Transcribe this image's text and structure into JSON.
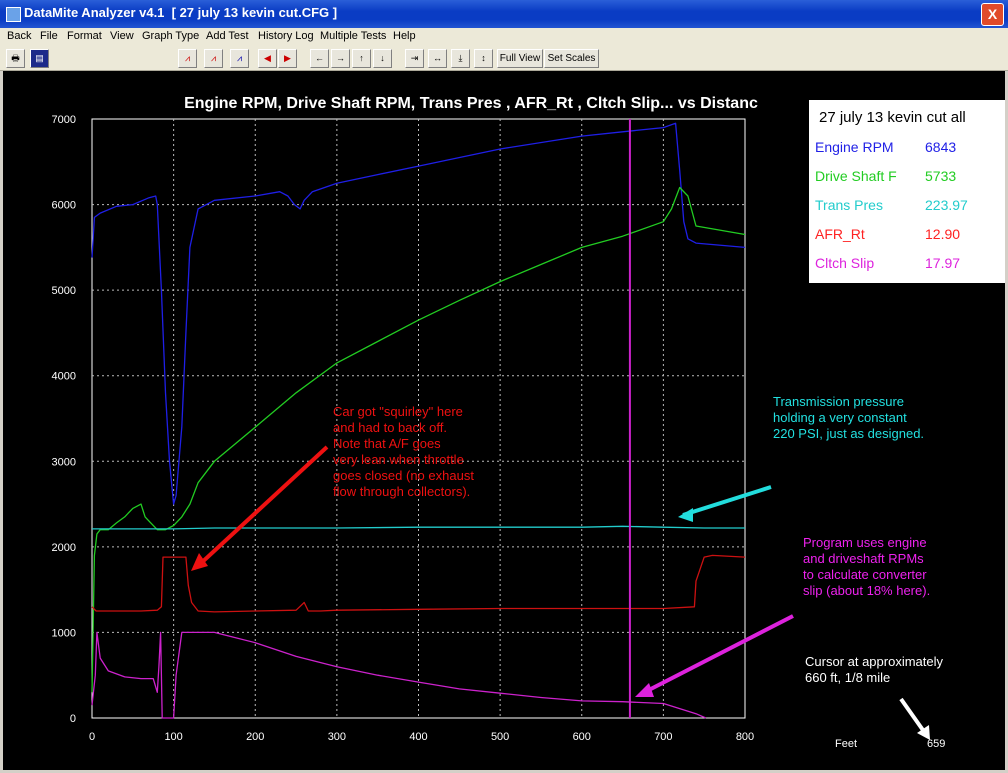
{
  "window": {
    "title": "DataMite Analyzer v4.1  [ 27 july 13 kevin cut.CFG ]",
    "close_glyph": "X"
  },
  "menu": [
    "Back",
    "File",
    "Format",
    "View",
    "Graph Type",
    "Add Test",
    "History Log",
    "Multiple Tests",
    "Help"
  ],
  "toolbar": {
    "icons": [
      "printer-icon",
      "save-icon",
      "graph-icon-1",
      "graph-icon-2",
      "graph-icon-3",
      "scroll-left-icon",
      "scroll-right-icon",
      "arrow-left-icon",
      "arrow-right-icon",
      "arrow-up-icon",
      "arrow-down-icon",
      "compress-horizontal-icon",
      "expand-horizontal-icon",
      "compress-vertical-icon",
      "expand-vertical-icon"
    ],
    "full_view": "Full View",
    "set_scales": "Set Scales"
  },
  "colors": {
    "engine_rpm": "#1f1fe6",
    "drive_shaft": "#22cc22",
    "trans_pres": "#22cccc",
    "afr": "#cc1111",
    "clutch_slip": "#cc22cc",
    "grid": "#bbbbbb",
    "cursor": "#cc22cc"
  },
  "legend": {
    "header": "27 july 13 kevin cut    all",
    "rows": [
      {
        "label": "Engine RPM",
        "value": "6843",
        "color": "#1f1fe6"
      },
      {
        "label": "Drive Shaft F",
        "value": "5733",
        "color": "#22cc22"
      },
      {
        "label": "Trans Pres",
        "value": "223.97",
        "color": "#22cccc"
      },
      {
        "label": "AFR_Rt",
        "value": "12.90",
        "color": "#ff2222"
      },
      {
        "label": "Cltch Slip",
        "value": "17.97",
        "color": "#dd22dd"
      }
    ]
  },
  "annotations": {
    "squirley": [
      "Car got \"squirley\" here",
      "and had to back off.",
      "Note that A/F goes",
      "very lean when throttle",
      "goes closed (no exhaust",
      "flow through collectors)."
    ],
    "transmission": [
      "Transmission pressure",
      "holding a very constant",
      "220 PSI, just as designed."
    ],
    "program": [
      "Program uses engine",
      "and driveshaft RPMs",
      "to calculate converter",
      "slip (about 18% here)."
    ],
    "cursor_note": [
      "Cursor at approximately",
      "660 ft, 1/8 mile"
    ]
  },
  "cursor_readout": {
    "label": "Feet",
    "value": "659"
  },
  "chart_data": {
    "type": "line",
    "title": "Engine RPM, Drive Shaft RPM, Trans Pres , AFR_Rt , Cltch Slip... vs Distanc",
    "xlabel": "Feet",
    "xlim": [
      0,
      800
    ],
    "ylim": [
      0,
      7000
    ],
    "x_ticks": [
      "0",
      "100",
      "200",
      "300",
      "400",
      "500",
      "600",
      "700",
      "800"
    ],
    "y_ticks": [
      "0",
      "1000",
      "2000",
      "3000",
      "4000",
      "5000",
      "6000",
      "7000"
    ],
    "grid": true,
    "cursor_x": 659,
    "series": [
      {
        "name": "Engine RPM",
        "color": "#1f1fe6",
        "x": [
          0,
          3,
          10,
          30,
          50,
          70,
          78,
          80,
          85,
          90,
          95,
          100,
          103,
          110,
          115,
          120,
          130,
          150,
          200,
          230,
          240,
          248,
          255,
          260,
          270,
          300,
          350,
          400,
          500,
          600,
          650,
          700,
          715,
          720,
          725,
          730,
          740,
          800
        ],
        "y": [
          5380,
          5850,
          5900,
          5980,
          6000,
          6080,
          6100,
          6000,
          5000,
          3800,
          3000,
          2500,
          2600,
          3400,
          4500,
          5500,
          5950,
          6050,
          6100,
          6150,
          6100,
          6000,
          5950,
          6050,
          6150,
          6250,
          6350,
          6450,
          6650,
          6800,
          6850,
          6900,
          6950,
          6400,
          5800,
          5600,
          5550,
          5500
        ]
      },
      {
        "name": "Drive Shaft RPM",
        "color": "#22cc22",
        "x": [
          0,
          3,
          6,
          10,
          20,
          30,
          40,
          50,
          60,
          65,
          70,
          80,
          90,
          100,
          110,
          120,
          130,
          150,
          200,
          250,
          300,
          350,
          400,
          450,
          500,
          550,
          600,
          650,
          700,
          710,
          720,
          730,
          740,
          800
        ],
        "y": [
          300,
          1900,
          2150,
          2200,
          2200,
          2280,
          2350,
          2450,
          2500,
          2350,
          2300,
          2200,
          2200,
          2250,
          2350,
          2500,
          2750,
          3000,
          3400,
          3800,
          4150,
          4400,
          4650,
          4880,
          5100,
          5300,
          5500,
          5630,
          5800,
          5950,
          6200,
          6100,
          5750,
          5650
        ]
      },
      {
        "name": "Trans Pres",
        "color": "#22cccc",
        "x": [
          0,
          50,
          100,
          150,
          200,
          300,
          400,
          500,
          600,
          650,
          700,
          750,
          800
        ],
        "y": [
          2210,
          2210,
          2210,
          2220,
          2220,
          2220,
          2230,
          2230,
          2230,
          2240,
          2230,
          2220,
          2220
        ]
      },
      {
        "name": "AFR_Rt",
        "color": "#cc1111",
        "x": [
          0,
          5,
          20,
          40,
          60,
          80,
          85,
          87,
          115,
          118,
          122,
          130,
          150,
          200,
          250,
          260,
          265,
          280,
          300,
          400,
          500,
          600,
          700,
          738,
          740,
          750,
          760,
          800
        ],
        "y": [
          1300,
          1250,
          1250,
          1250,
          1250,
          1260,
          1300,
          1880,
          1880,
          1550,
          1350,
          1250,
          1240,
          1250,
          1260,
          1350,
          1250,
          1250,
          1260,
          1270,
          1280,
          1280,
          1280,
          1300,
          1600,
          1880,
          1900,
          1880
        ]
      },
      {
        "name": "Cltch Slip",
        "color": "#cc22cc",
        "x": [
          0,
          4,
          6,
          10,
          20,
          40,
          60,
          75,
          80,
          82,
          84,
          86,
          90,
          95,
          100,
          103,
          110,
          120,
          130,
          150,
          200,
          250,
          300,
          350,
          400,
          450,
          500,
          550,
          600,
          650,
          700,
          720,
          740,
          752
        ],
        "y": [
          150,
          500,
          1000,
          700,
          550,
          480,
          460,
          460,
          300,
          600,
          1000,
          0,
          0,
          0,
          0,
          500,
          1000,
          1000,
          1000,
          1000,
          880,
          720,
          600,
          500,
          420,
          340,
          290,
          240,
          200,
          190,
          170,
          110,
          50,
          0
        ]
      }
    ]
  }
}
